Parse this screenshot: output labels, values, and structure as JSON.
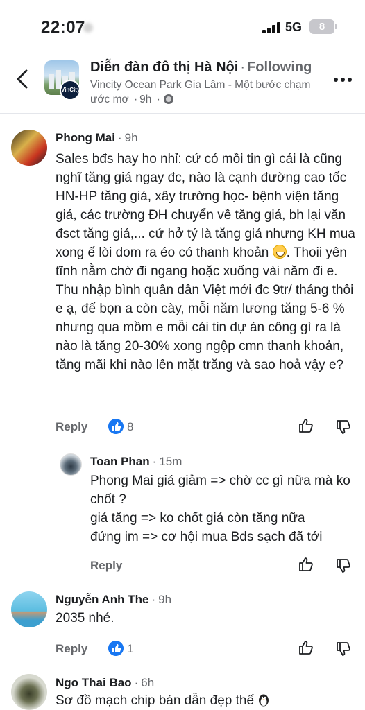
{
  "status_bar": {
    "time": "22:07",
    "network": "5G",
    "battery": "8"
  },
  "header": {
    "group_name": "Diễn đàn đô thị Hà Nội",
    "separator": "·",
    "following": "Following",
    "post_subtitle": "Vincity Ocean Park Gia Lâm - Một bước chạm ước mơ",
    "post_time": "9h",
    "badge_text": "VinCity"
  },
  "comments": [
    {
      "author": "Phong Mai",
      "time": "9h",
      "text_before_emoji": "Sales bđs hay ho nhỉ: cứ có mồi tin gì cái là cũng nghĩ tăng giá ngay đc, nào là cạnh đường cao tốc HN-HP tăng giá, xây trường học- bệnh viện tăng giá, các trường ĐH chuyển về tăng giá, bh lại văn đsct tăng giá,... cứ hở tý là tăng giá nhưng KH mua xong ế lòi dom ra éo có thanh khoản",
      "text_after_emoji": ". Thoii yên tĩnh nằm chờ đi ngang hoặc xuống vài năm đi e. Thu nhập bình quân dân Việt mới đc 9tr/ tháng thôi e ạ, để bọn a còn cày, mỗi năm lương tăng 5-6 % nhưng qua mồm e mỗi cái tin dự án công gì ra là nào là tăng 20-30% xong ngộp cmn thanh khoản, tăng mãi khi nào lên mặt trăng và sao hoả vậy e?",
      "reply_label": "Reply",
      "likes": "8"
    },
    {
      "author": "Toan Phan",
      "time": "15m",
      "lines": [
        "Phong Mai giá giảm => chờ cc gì nữa mà ko chốt ?",
        "giá tăng => ko chốt giá còn tăng nữa",
        "đứng im => cơ hội mua Bds sạch đã tới"
      ],
      "reply_label": "Reply"
    },
    {
      "author": "Nguyễn Anh The",
      "time": "9h",
      "text": "2035 nhé.",
      "reply_label": "Reply",
      "likes": "1"
    },
    {
      "author": "Ngo Thai Bao",
      "time": "6h",
      "text": "Sơ đồ mạch chip bán dẫn đẹp thế"
    }
  ],
  "colors": {
    "accent_blue": "#1877f2",
    "secondary_text": "#65676b",
    "primary_text": "#1c1e21",
    "divider": "#e4e6eb"
  },
  "icons": [
    "back-chevron-icon",
    "globe-icon",
    "more-icon",
    "like-badge-icon",
    "thumbs-up-icon",
    "thumbs-down-icon",
    "grin-emoji-icon",
    "penguin-emoji-icon"
  ]
}
